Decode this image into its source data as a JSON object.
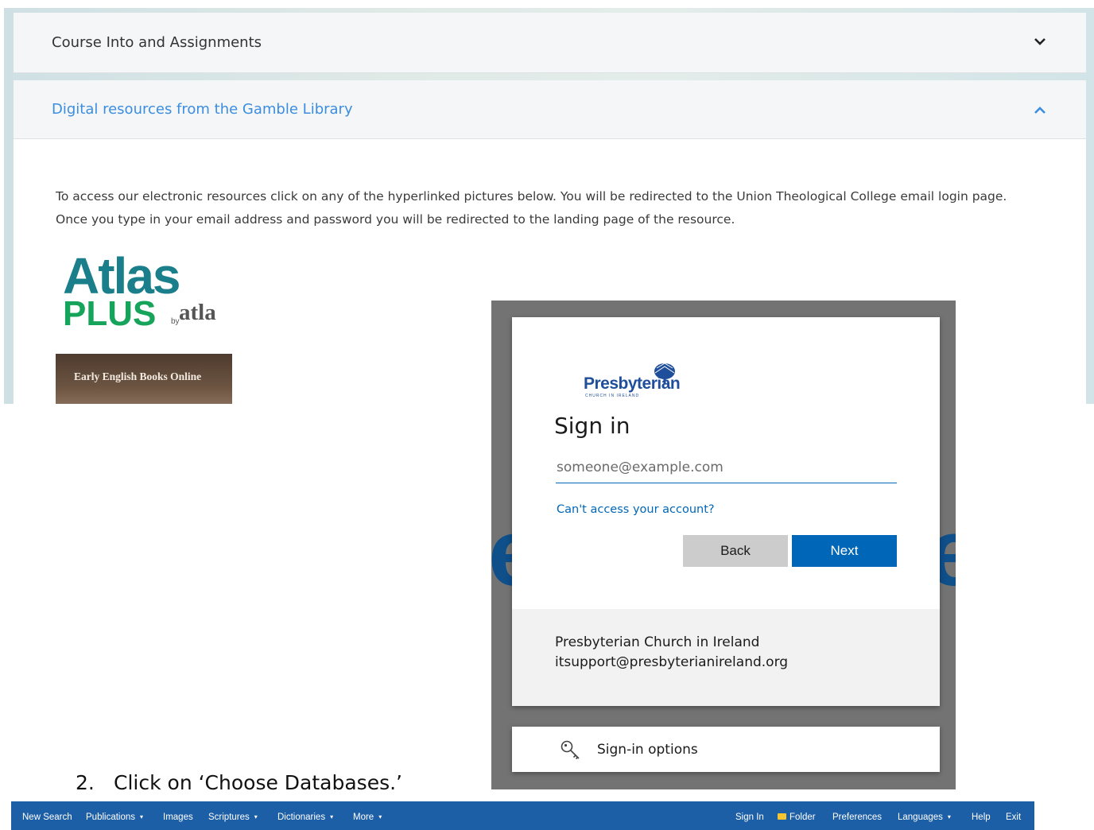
{
  "accordion": {
    "item1": {
      "title": "Course Into and Assignments"
    },
    "item2": {
      "title": "Digital resources from the Gamble Library"
    }
  },
  "panel": {
    "paragraph_line1": "To access our electronic resources click on any of the hyperlinked pictures below. You will be redirected to the Union Theological College email login page.",
    "paragraph_line2": "Once you type in your email address and password you will be redirected to the landing page of the resource.",
    "atlas_logo": {
      "word1": "Atlas",
      "word2": "PLUS",
      "by": "by",
      "brand": "atla"
    },
    "eebo_label": "Early English Books Online"
  },
  "signin": {
    "org_logo_text": "Presbyterian",
    "org_logo_sub": "CHURCH IN IRELAND",
    "title": "Sign in",
    "email_placeholder": "someone@example.com",
    "cant_access": "Can't access your account?",
    "back_label": "Back",
    "next_label": "Next",
    "footer_line1": "Presbyterian Church in Ireland",
    "footer_line2": "itsupport@presbyterianireland.org",
    "options_label": "Sign-in options",
    "brand_color": "#0067b8"
  },
  "step": {
    "number": "2.",
    "text": "Click on ‘Choose Databases.’"
  },
  "navbar": {
    "left": [
      "New Search",
      "Publications",
      "Images",
      "Scriptures",
      "Dictionaries",
      "More"
    ],
    "right": [
      "Sign In",
      "Folder",
      "Preferences",
      "Languages",
      "Help",
      "Exit"
    ],
    "color": "#1d5fa6"
  }
}
